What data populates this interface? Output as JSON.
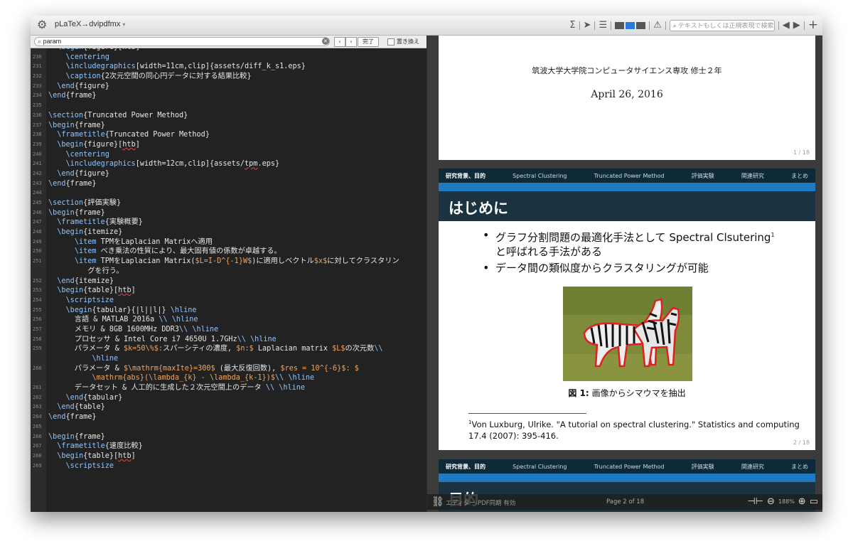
{
  "toolbar": {
    "engine_label": "pLaTeX→dvipdfmx",
    "search_placeholder": "テキストもしくは正規表現で検索"
  },
  "find": {
    "query": "param",
    "done_label": "完了",
    "replace_label": "置き換え"
  },
  "editor": {
    "lines": [
      {
        "n": "",
        "html": "  <span class='cmd'>\\begin</span>{figure}[htb]"
      },
      {
        "n": "230",
        "html": "    <span class='cmd'>\\centering</span>"
      },
      {
        "n": "231",
        "html": "    <span class='cmd'>\\includegraphics</span>[width=11cm,clip]{assets/diff_k_s1.eps}"
      },
      {
        "n": "232",
        "html": "    <span class='cmd'>\\caption</span>{2次元空間の同心円データに対する結果比較}"
      },
      {
        "n": "233",
        "html": "  <span class='cmd'>\\end</span>{figure}"
      },
      {
        "n": "234",
        "html": "<span class='cmd'>\\end</span>{frame}"
      },
      {
        "n": "235",
        "html": ""
      },
      {
        "n": "236",
        "html": "<span class='cmd'>\\section</span>{Truncated Power Method}"
      },
      {
        "n": "237",
        "html": "<span class='cmd'>\\begin</span>{frame}"
      },
      {
        "n": "238",
        "html": "  <span class='cmd'>\\frametitle</span>{Truncated Power Method}"
      },
      {
        "n": "239",
        "html": "  <span class='cmd'>\\begin</span>{figure}[<span class='err'>htb</span>]"
      },
      {
        "n": "240",
        "html": "    <span class='cmd'>\\centering</span>"
      },
      {
        "n": "241",
        "html": "    <span class='cmd'>\\includegraphics</span>[width=12cm,clip]{assets/<span class='err'>tpm</span>.eps}"
      },
      {
        "n": "242",
        "html": "  <span class='cmd'>\\end</span>{figure}"
      },
      {
        "n": "243",
        "html": "<span class='cmd'>\\end</span>{frame}"
      },
      {
        "n": "244",
        "html": ""
      },
      {
        "n": "245",
        "html": "<span class='cmd'>\\section</span>{評価実験}"
      },
      {
        "n": "246",
        "html": "<span class='cmd'>\\begin</span>{frame}"
      },
      {
        "n": "247",
        "html": "  <span class='cmd'>\\frametitle</span>{実験概要}"
      },
      {
        "n": "248",
        "html": "  <span class='cmd'>\\begin</span>{itemize}"
      },
      {
        "n": "249",
        "html": "      <span class='cmd'>\\item</span> TPMをLaplacian Matrixへ適用"
      },
      {
        "n": "250",
        "html": "      <span class='cmd'>\\item</span> べき乗法の性質により、最大固有値の係数が卓越する。"
      },
      {
        "n": "251",
        "html": "      <span class='cmd'>\\item</span> TPMをLaplacian Matrix(<span class='math'>$L=I-D^{-1}W$</span>)に適用しベクトル<span class='math'>$x$</span>に対してクラスタリン"
      },
      {
        "n": "",
        "html": "         グを行う。"
      },
      {
        "n": "252",
        "html": "  <span class='cmd'>\\end</span>{itemize}"
      },
      {
        "n": "253",
        "html": "  <span class='cmd'>\\begin</span>{table}[<span class='err'>htb</span>]"
      },
      {
        "n": "254",
        "html": "    <span class='cmd'>\\scriptsize</span>"
      },
      {
        "n": "255",
        "html": "    <span class='cmd'>\\begin</span>{tabular}{|l||l|} <span class='cmd'>\\hline</span>"
      },
      {
        "n": "256",
        "html": "      言語 &amp; MATLAB 2016a <span class='cmd'>\\\\ \\hline</span>"
      },
      {
        "n": "257",
        "html": "      メモリ &amp; 8GB 1600MHz DDR3<span class='cmd'>\\\\ \\hline</span>"
      },
      {
        "n": "258",
        "html": "      プロセッサ &amp; Intel Core i7 4650U 1.7GHz<span class='cmd'>\\\\ \\hline</span>"
      },
      {
        "n": "259",
        "html": "      パラメータ &amp; <span class='math'>$k=50\\%$:</span>スパーシティの濃度, <span class='math'>$n:$</span> Laplacian matrix <span class='math'>$L$</span>の次元数<span class='cmd'>\\\\</span>"
      },
      {
        "n": "",
        "html": "          <span class='cmd'>\\hline</span>"
      },
      {
        "n": "260",
        "html": "      パラメータ &amp; <span class='math'>$\\mathrm{maxIte}=300$</span> (最大反復回数), <span class='math'>$res = 10^{-6}$: $</span>"
      },
      {
        "n": "",
        "html": "          <span class='math'>\\mathrm{abs}(\\lambda_{k} - \\lambda_{k-1})$</span><span class='cmd'>\\\\ \\hline</span>"
      },
      {
        "n": "261",
        "html": "      データセット &amp; 人工的に生成した２次元空間上のデータ <span class='cmd'>\\\\ \\hline</span>"
      },
      {
        "n": "262",
        "html": "    <span class='cmd'>\\end</span>{tabular}"
      },
      {
        "n": "263",
        "html": "  <span class='cmd'>\\end</span>{table}"
      },
      {
        "n": "264",
        "html": "<span class='cmd'>\\end</span>{frame}"
      },
      {
        "n": "265",
        "html": ""
      },
      {
        "n": "266",
        "html": "<span class='cmd'>\\begin</span>{frame}"
      },
      {
        "n": "267",
        "html": "  <span class='cmd'>\\frametitle</span>{速度比較}"
      },
      {
        "n": "268",
        "html": "  <span class='cmd'>\\begin</span>{table}[<span class='err'>htb</span>]"
      },
      {
        "n": "269",
        "html": "    <span class='cmd'>\\scriptsize</span>"
      }
    ]
  },
  "preview": {
    "page1": {
      "affiliation": "筑波大学大学院コンピュータサイエンス専攻 修士２年",
      "date": "April 26, 2016",
      "page_number": "1 / 18"
    },
    "page2": {
      "nav": [
        "研究背景、目的",
        "Spectral Clustering",
        "Truncated Power Method",
        "評価実験",
        "関連研究",
        "まとめ"
      ],
      "title": "はじめに",
      "bullet1": "グラフ分割問題の最適化手法として Spectral Clsutering",
      "bullet1_sup": "1",
      "bullet1_cont": "と呼ばれる手法がある",
      "bullet2": "データ間の類似度からクラスタリングが可能",
      "figure_label": "図 1:",
      "figure_caption": "画像からシマウマを抽出",
      "footnote_mark": "1",
      "footnote": "Von Luxburg, Ulrike. \"A tutorial on spectral clustering.\" Statistics and computing 17.4 (2007): 395-416.",
      "page_number": "2 / 18"
    },
    "page3": {
      "nav": [
        "研究背景、目的",
        "Spectral Clustering",
        "Truncated Power Method",
        "評価実験",
        "関連研究",
        "まとめ"
      ],
      "title": "目的"
    }
  },
  "status": {
    "sync_label": "エディター-PDF同期  有効",
    "page_label": "Page 2 of 18",
    "zoom": "188%"
  }
}
